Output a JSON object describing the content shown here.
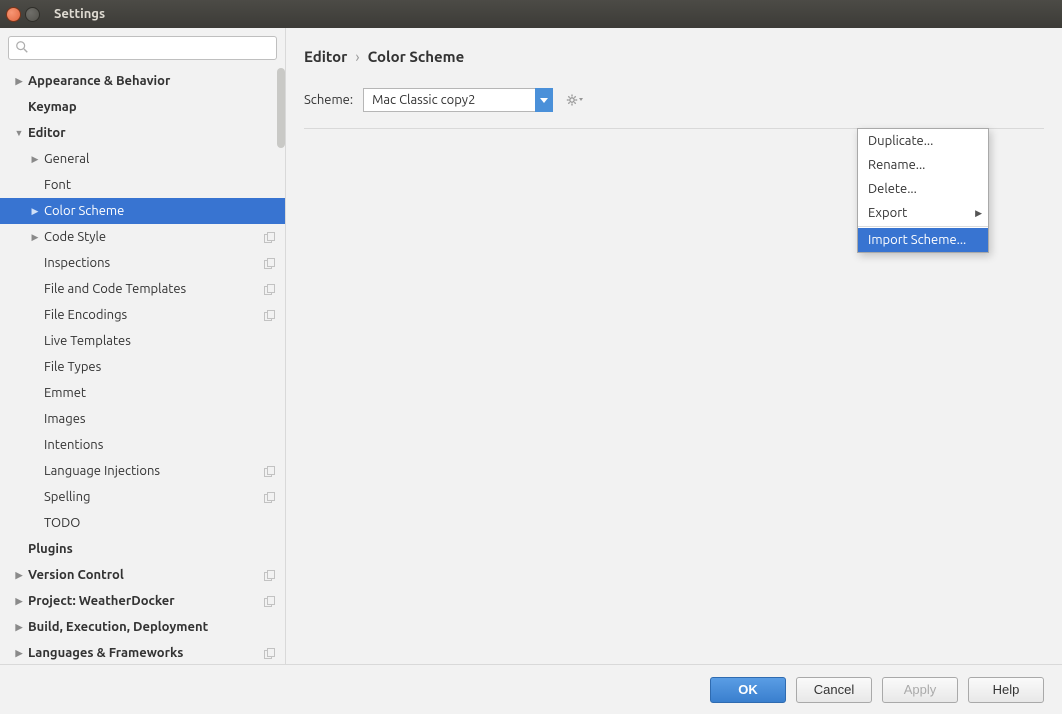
{
  "window": {
    "title": "Settings"
  },
  "search": {
    "placeholder": ""
  },
  "tree": {
    "items": [
      {
        "label": "Appearance & Behavior",
        "bold": true,
        "chev": "▶",
        "level": 0
      },
      {
        "label": "Keymap",
        "bold": true,
        "level": 0
      },
      {
        "label": "Editor",
        "bold": true,
        "chev": "▼",
        "level": 0
      },
      {
        "label": "General",
        "chev": "▶",
        "level": 1
      },
      {
        "label": "Font",
        "level": 1
      },
      {
        "label": "Color Scheme",
        "chev": "▶",
        "level": 1,
        "selected": true
      },
      {
        "label": "Code Style",
        "chev": "▶",
        "level": 1,
        "copy": true
      },
      {
        "label": "Inspections",
        "level": 1,
        "copy": true
      },
      {
        "label": "File and Code Templates",
        "level": 1,
        "copy": true
      },
      {
        "label": "File Encodings",
        "level": 1,
        "copy": true
      },
      {
        "label": "Live Templates",
        "level": 1
      },
      {
        "label": "File Types",
        "level": 1
      },
      {
        "label": "Emmet",
        "level": 1
      },
      {
        "label": "Images",
        "level": 1
      },
      {
        "label": "Intentions",
        "level": 1
      },
      {
        "label": "Language Injections",
        "level": 1,
        "copy": true
      },
      {
        "label": "Spelling",
        "level": 1,
        "copy": true
      },
      {
        "label": "TODO",
        "level": 1
      },
      {
        "label": "Plugins",
        "bold": true,
        "level": 0
      },
      {
        "label": "Version Control",
        "bold": true,
        "chev": "▶",
        "level": 0,
        "copy": true
      },
      {
        "label": "Project: WeatherDocker",
        "bold": true,
        "chev": "▶",
        "level": 0,
        "copy": true
      },
      {
        "label": "Build, Execution, Deployment",
        "bold": true,
        "chev": "▶",
        "level": 0
      },
      {
        "label": "Languages & Frameworks",
        "bold": true,
        "chev": "▶",
        "level": 0,
        "copy": true
      }
    ]
  },
  "breadcrumb": {
    "part1": "Editor",
    "sep": "›",
    "part2": "Color Scheme"
  },
  "scheme": {
    "label": "Scheme:",
    "value": "Mac Classic copy2"
  },
  "context_menu": {
    "items": [
      {
        "label": "Duplicate..."
      },
      {
        "label": "Rename..."
      },
      {
        "label": "Delete..."
      },
      {
        "label": "Export",
        "submenu": true
      },
      {
        "sep": true
      },
      {
        "label": "Import Scheme...",
        "highlight": true
      }
    ]
  },
  "buttons": {
    "ok": "OK",
    "cancel": "Cancel",
    "apply": "Apply",
    "help": "Help"
  }
}
